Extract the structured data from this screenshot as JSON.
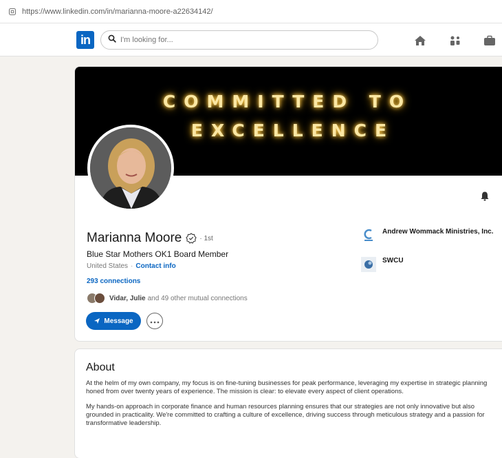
{
  "browser": {
    "url": "https://www.linkedin.com/in/marianna-moore-a22634142/"
  },
  "nav": {
    "logo_text": "in",
    "search_placeholder": "I'm looking for..."
  },
  "banner": {
    "line1": "COMMITTED TO",
    "line2": "EXCELLENCE",
    "glow_color": "#fbe7a3"
  },
  "profile": {
    "name": "Marianna Moore",
    "degree": "· 1st",
    "headline": "Blue Star Mothers OK1 Board Member",
    "location": "United States",
    "location_separator": "·",
    "contact_info": "Contact info",
    "connections": "293 connections",
    "mutual_names": "Vidar, Julie",
    "mutual_rest": "and 49 other mutual connections",
    "message_label": "Message"
  },
  "organizations": [
    {
      "name": "Andrew Wommack Ministries, Inc.",
      "icon": "ministry-logo-icon"
    },
    {
      "name": "SWCU",
      "icon": "swcu-logo-icon"
    }
  ],
  "about": {
    "title": "About",
    "paragraph1": "At the helm of my own company, my focus is on fine-tuning businesses for peak performance, leveraging my expertise in strategic planning honed from over twenty years of experience. The mission is clear: to elevate every aspect of client operations.",
    "paragraph2": "My hands-on approach in corporate finance and human resources planning ensures that our strategies are not only innovative but also grounded in practicality. We're committed to crafting a culture of excellence, driving success through meticulous strategy and a passion for transformative leadership."
  },
  "colors": {
    "brand": "#0a66c2",
    "background": "#f4f2ee"
  }
}
